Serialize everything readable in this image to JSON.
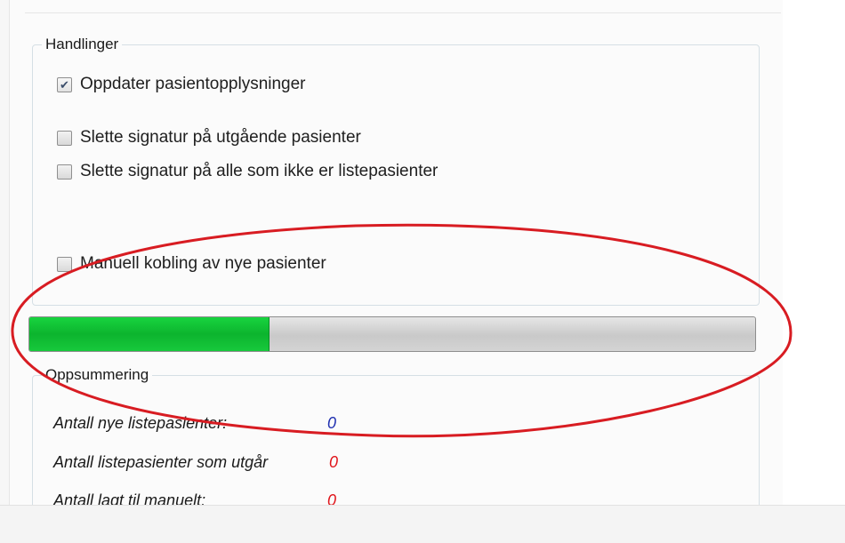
{
  "actions": {
    "legend": "Handlinger",
    "checkboxes": [
      {
        "label": "Oppdater pasientopplysninger",
        "checked": true
      },
      {
        "label": "Slette signatur på utgående pasienter",
        "checked": false
      },
      {
        "label": "Slette signatur på alle som ikke er listepasienter",
        "checked": false
      },
      {
        "label": "Manuell kobling av nye pasienter",
        "checked": false
      }
    ]
  },
  "progress": {
    "value_percent": 33,
    "fill_color": "#0cb42e"
  },
  "summary": {
    "legend": "Oppsummering",
    "rows": [
      {
        "label": "Antall nye listepasienter:",
        "value": "0",
        "value_color": "#1f2fb0"
      },
      {
        "label": "Antall listepasienter som utgår",
        "value": "0",
        "value_color": "#e0141a"
      },
      {
        "label": "Antall lagt til manuelt:",
        "value": "0",
        "value_color": "#e0141a"
      }
    ]
  },
  "annotation": {
    "shape": "ellipse",
    "color": "#d81c22"
  }
}
